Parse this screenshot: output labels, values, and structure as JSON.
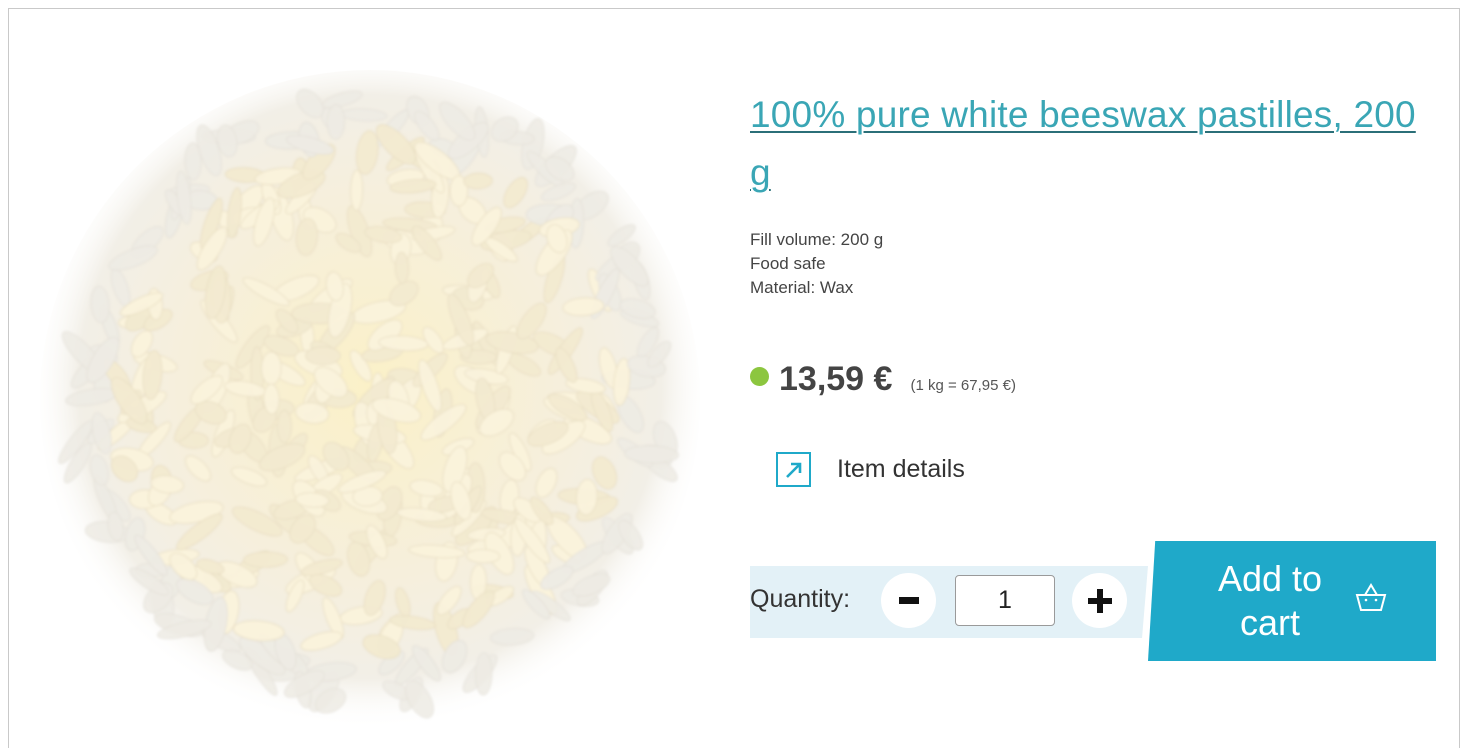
{
  "product": {
    "title": "100% pure white beeswax pastilles, 200 g",
    "attributes": [
      "Fill volume: 200 g",
      "Food safe",
      "Material: Wax"
    ],
    "price": "13,59 €",
    "unit_price": "(1 kg = 67,95 €)",
    "stock_color": "#8cc63f"
  },
  "details": {
    "label": "Item details",
    "icon": "external-link-arrow-icon"
  },
  "quantity": {
    "label": "Quantity:",
    "value": "1",
    "minus_icon": "minus-icon",
    "plus_icon": "plus-icon"
  },
  "cart": {
    "label": "Add to cart",
    "icon": "shopping-basket-icon"
  },
  "colors": {
    "accent": "#1fa9c9",
    "title": "#3aa6b5",
    "panel": "#e3f1f7"
  }
}
